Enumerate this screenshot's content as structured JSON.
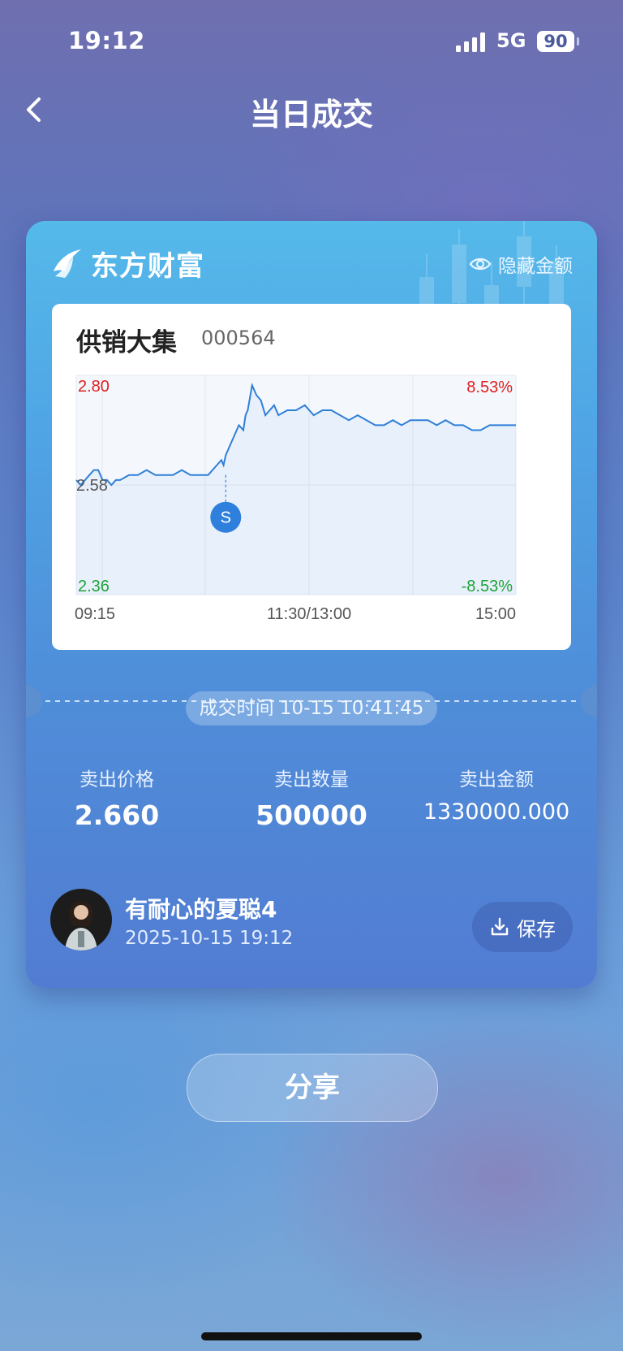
{
  "status_bar": {
    "time": "19:12",
    "network": "5G",
    "battery": "90"
  },
  "nav": {
    "title": "当日成交"
  },
  "card": {
    "brand": "东方财富",
    "hide_amount_label": "隐藏金额",
    "stock": {
      "name": "供销大集",
      "code": "000564"
    },
    "deal_time": "成交时间 10-15 10:41:45",
    "stats": [
      {
        "label": "卖出价格",
        "value": "2.660"
      },
      {
        "label": "卖出数量",
        "value": "500000"
      },
      {
        "label": "卖出金额",
        "value": "1330000.000"
      }
    ],
    "user": {
      "name": "有耐心的夏聪4",
      "datetime": "2025-10-15 19:12"
    },
    "save_label": "保存"
  },
  "share_label": "分享",
  "colors": {
    "up": "#e02020",
    "down": "#1fa33a",
    "line": "#2f7fd8",
    "marker": "#2f80dd"
  },
  "chart_data": {
    "type": "line",
    "y_left_labels": {
      "top": "2.80",
      "mid": "2.58",
      "bottom": "2.36"
    },
    "y_right_labels": {
      "top": "8.53%",
      "bottom": "-8.53%"
    },
    "x_labels": [
      "09:15",
      "11:30/13:00",
      "15:00"
    ],
    "ylim": [
      2.36,
      2.8
    ],
    "prev_close": 2.58,
    "marker": {
      "label": "S",
      "x": 0.34,
      "y": 2.6
    },
    "x": [
      0,
      0.01,
      0.02,
      0.03,
      0.04,
      0.05,
      0.06,
      0.07,
      0.08,
      0.09,
      0.1,
      0.12,
      0.14,
      0.16,
      0.18,
      0.2,
      0.22,
      0.24,
      0.26,
      0.28,
      0.3,
      0.32,
      0.33,
      0.335,
      0.34,
      0.35,
      0.36,
      0.37,
      0.38,
      0.385,
      0.39,
      0.4,
      0.41,
      0.42,
      0.43,
      0.44,
      0.45,
      0.46,
      0.48,
      0.5,
      0.52,
      0.54,
      0.56,
      0.58,
      0.6,
      0.62,
      0.64,
      0.66,
      0.68,
      0.7,
      0.72,
      0.74,
      0.76,
      0.78,
      0.8,
      0.82,
      0.84,
      0.86,
      0.88,
      0.9,
      0.92,
      0.94,
      0.96,
      0.98,
      1.0
    ],
    "y": [
      2.59,
      2.58,
      2.59,
      2.6,
      2.61,
      2.61,
      2.59,
      2.59,
      2.58,
      2.59,
      2.59,
      2.6,
      2.6,
      2.61,
      2.6,
      2.6,
      2.6,
      2.61,
      2.6,
      2.6,
      2.6,
      2.62,
      2.63,
      2.62,
      2.64,
      2.66,
      2.68,
      2.7,
      2.69,
      2.72,
      2.73,
      2.78,
      2.76,
      2.75,
      2.72,
      2.73,
      2.74,
      2.72,
      2.73,
      2.73,
      2.74,
      2.72,
      2.73,
      2.73,
      2.72,
      2.71,
      2.72,
      2.71,
      2.7,
      2.7,
      2.71,
      2.7,
      2.71,
      2.71,
      2.71,
      2.7,
      2.71,
      2.7,
      2.7,
      2.69,
      2.69,
      2.7,
      2.7,
      2.7,
      2.7
    ]
  }
}
